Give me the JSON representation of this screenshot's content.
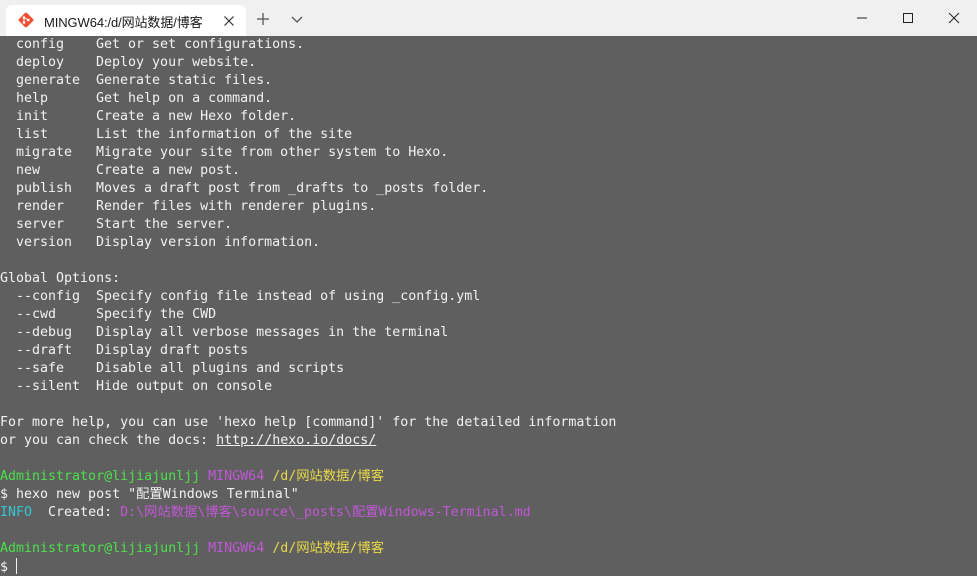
{
  "tab": {
    "title": "MINGW64:/d/网站数据/博客",
    "icon": "git-icon"
  },
  "window_controls": {
    "new_tab": "plus-icon",
    "dropdown": "chevron-down-icon",
    "minimize": "minimize-icon",
    "maximize": "maximize-icon",
    "close": "close-icon"
  },
  "colors": {
    "background": "#5f5f5f",
    "foreground": "#f2f2f2",
    "prompt_user": "#4be14b",
    "prompt_host": "#c158d6",
    "prompt_path": "#e8d94a",
    "info": "#35c6d4"
  },
  "commands": [
    {
      "name": "config",
      "desc": "Get or set configurations."
    },
    {
      "name": "deploy",
      "desc": "Deploy your website."
    },
    {
      "name": "generate",
      "desc": "Generate static files."
    },
    {
      "name": "help",
      "desc": "Get help on a command."
    },
    {
      "name": "init",
      "desc": "Create a new Hexo folder."
    },
    {
      "name": "list",
      "desc": "List the information of the site"
    },
    {
      "name": "migrate",
      "desc": "Migrate your site from other system to Hexo."
    },
    {
      "name": "new",
      "desc": "Create a new post."
    },
    {
      "name": "publish",
      "desc": "Moves a draft post from _drafts to _posts folder."
    },
    {
      "name": "render",
      "desc": "Render files with renderer plugins."
    },
    {
      "name": "server",
      "desc": "Start the server."
    },
    {
      "name": "version",
      "desc": "Display version information."
    }
  ],
  "global_options": {
    "heading": "Global Options:",
    "options": [
      {
        "name": "--config",
        "desc": "Specify config file instead of using _config.yml"
      },
      {
        "name": "--cwd",
        "desc": "Specify the CWD"
      },
      {
        "name": "--debug",
        "desc": "Display all verbose messages in the terminal"
      },
      {
        "name": "--draft",
        "desc": "Display draft posts"
      },
      {
        "name": "--safe",
        "desc": "Disable all plugins and scripts"
      },
      {
        "name": "--silent",
        "desc": "Hide output on console"
      }
    ]
  },
  "help_footer": {
    "line1": "For more help, you can use 'hexo help [command]' for the detailed information",
    "line2_prefix": "or you can check the docs: ",
    "docs_url": "http://hexo.io/docs/"
  },
  "prompt1": {
    "user": "Administrator@lijiajunljj",
    "host": "MINGW64",
    "path": "/d/网站数据/博客"
  },
  "command_line": "$ hexo new post \"配置Windows Terminal\"",
  "info_line": {
    "tag": "INFO",
    "label": "  Created: ",
    "path": "D:\\网站数据\\博客\\source\\_posts\\配置Windows-Terminal.md"
  },
  "prompt2": {
    "user": "Administrator@lijiajunljj",
    "host": "MINGW64",
    "path": "/d/网站数据/博客"
  },
  "input_prompt": "$ "
}
